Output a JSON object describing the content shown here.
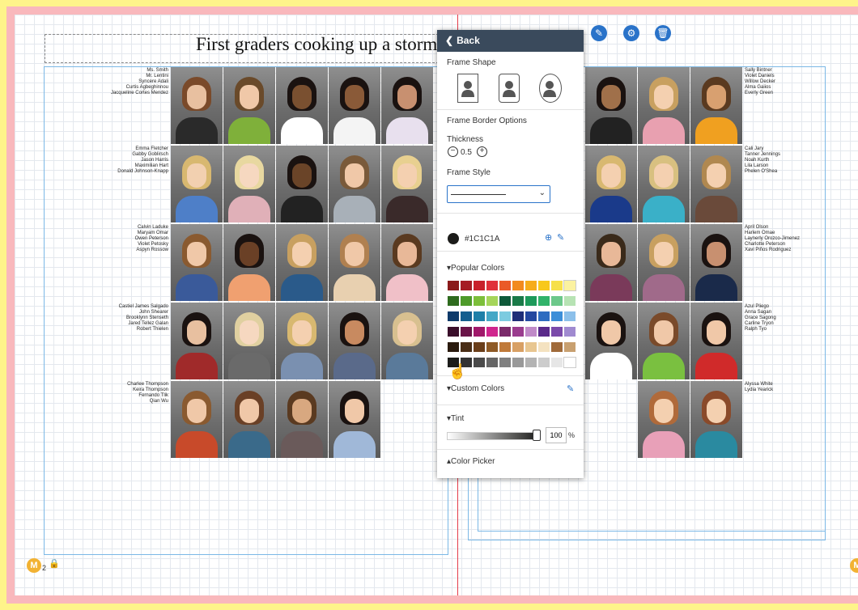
{
  "spread": {
    "title": "First graders cooking up a storm",
    "page_number": "2"
  },
  "name_groups": {
    "left": [
      [
        "Ms. Smith",
        "Mr. Lentini",
        "Syncere Adali",
        "Curtis Agbeghinnou",
        "Jacqueline Cortes Mendez"
      ],
      [
        "Emma Fletcher",
        "Gabby Goblirsch",
        "Jason Harris",
        "Maximilian Hart",
        "Donald Johnson-Knapp"
      ],
      [
        "Calvin Laduke",
        "Maryam Omar",
        "Owen Peterson",
        "Violet Petosky",
        "Aspyn Rossow"
      ],
      [
        "Castiel James Salgado",
        "John Shearer",
        "Brooklynn Stenseth",
        "Jared Tellez Galan",
        "Robert Thielen"
      ],
      [
        "Charlee Thompson",
        "Keira Thompson",
        "Fernando Tlik",
        "Qian Wu"
      ]
    ],
    "right": [
      [
        "Sally Bintner",
        "Violet Daniels",
        "Willow Decker",
        "Alma Gaiios",
        "Everly Green"
      ],
      [
        "Cali Jary",
        "Tanner Jennings",
        "Noah Kurth",
        "Lila Larson",
        "Phelen O'Shea"
      ],
      [
        "April Olson",
        "Harlem Omae",
        "Laynerly Orozco-Jimenez",
        "Charlotte Peterson",
        "Xavi Piños Rodriguez"
      ],
      [
        "Azul Pliego",
        "Anna Sagan",
        "Grace Sagong",
        "Carline Tryon",
        "Ralph Tyo"
      ],
      [
        "Alyssa White",
        "Lydia Yearick"
      ]
    ]
  },
  "toolbar_icons": [
    "pencil-icon",
    "gear-icon",
    "trash-icon"
  ],
  "panel": {
    "back_label": "Back",
    "frame_shape_label": "Frame Shape",
    "border_options_label": "Frame Border Options",
    "thickness_label": "Thickness",
    "thickness_value": "0.5",
    "frame_style_label": "Frame Style",
    "current_color": "#1C1C1A",
    "popular_colors_label": "Popular Colors",
    "custom_colors_label": "Custom Colors",
    "tint_label": "Tint",
    "tint_value": "100",
    "tint_unit": "%",
    "color_picker_label": "Color Picker"
  },
  "swatches": [
    [
      "#8b1a1a",
      "#a51c24",
      "#c8202b",
      "#e0303a",
      "#ea5a28",
      "#f28a1e",
      "#f6ac1a",
      "#f8c81c",
      "#f6e04a",
      "#fbf2a0"
    ],
    [
      "#2e6b1e",
      "#4e9a2a",
      "#7cbf3a",
      "#a5d55a",
      "#0f5a3a",
      "#1a7a48",
      "#1d9a5a",
      "#31b36a",
      "#6cc88a",
      "#b7e3b4"
    ],
    [
      "#0e3a6a",
      "#145e8e",
      "#1e7fa8",
      "#44a7c6",
      "#7ccbe0",
      "#1e2e78",
      "#2448a0",
      "#2e6cc0",
      "#3c8ed8",
      "#8cc0ea"
    ],
    [
      "#3a0e2a",
      "#6a1448",
      "#a0186a",
      "#d0268e",
      "#7a2a6a",
      "#9a3c8e",
      "#c08ac8",
      "#5a2a8a",
      "#7a4aaa",
      "#a08ad0"
    ],
    [
      "#2a1a0e",
      "#4a2e16",
      "#6a3e1a",
      "#8e5a26",
      "#c07a3a",
      "#d8a064",
      "#e8c690",
      "#f4e2c0",
      "#a06a3a",
      "#c8a070"
    ],
    [
      "#1C1C1A",
      "#333333",
      "#4a4a4a",
      "#666666",
      "#808080",
      "#999999",
      "#b3b3b3",
      "#cccccc",
      "#e6e6e6",
      "#ffffff"
    ]
  ],
  "photos_left": [
    [
      [
        "#7a4a2a",
        "#e8c0a0",
        "#2a2a2a"
      ],
      [
        "#6a4a2a",
        "#f0c8a8",
        "#7fb03a"
      ],
      [
        "#1a1210",
        "#7a5030",
        "#ffffff"
      ],
      [
        "#1a1210",
        "#8a5a38",
        "#f4f4f4"
      ],
      [
        "#1a1210",
        "#c89070",
        "#e8e0ee"
      ]
    ],
    [
      [
        "#d8b870",
        "#f2d0b0",
        "#4e7fc8"
      ],
      [
        "#e8d8a0",
        "#f6d8c0",
        "#e0b0b8"
      ],
      [
        "#1a1210",
        "#6a4428",
        "#222222"
      ],
      [
        "#7a5a3a",
        "#f0c8a8",
        "#a8b0b8"
      ],
      [
        "#e8d090",
        "#f4d0b0",
        "#3a2a2a"
      ]
    ],
    [
      [
        "#8a5a30",
        "#f0c8a8",
        "#3a5a9a"
      ],
      [
        "#1a1210",
        "#6a4026",
        "#f0a070"
      ],
      [
        "#c8a060",
        "#f4d0b0",
        "#2a5a8a"
      ],
      [
        "#b08050",
        "#f0c8a8",
        "#e8d0b0"
      ],
      [
        "#5a3a20",
        "#e8b898",
        "#f0c0c8"
      ]
    ],
    [
      [
        "#1a1210",
        "#e8c0a0",
        "#a02a2a"
      ],
      [
        "#e0d0a0",
        "#f6d8c0",
        "#6a6a6a"
      ],
      [
        "#d8b870",
        "#f4d0b0",
        "#7a90b0"
      ],
      [
        "#1a1210",
        "#c88a60",
        "#5a6a8a"
      ],
      [
        "#d8c090",
        "#f4d0b0",
        "#5a7a9a"
      ]
    ],
    [
      [
        "#8a5a30",
        "#f0c8a8",
        "#c84a2a"
      ],
      [
        "#6a4026",
        "#f0c8a8",
        "#3a6a8a"
      ],
      [
        "#5a3a20",
        "#d8a880",
        "#6a5a5a"
      ],
      [
        "#1a1210",
        "#f0c8a8",
        "#a0b8d8"
      ]
    ]
  ],
  "photos_right": [
    [
      [
        "#1a1210",
        "#a0704a",
        "#222222"
      ],
      [
        "#c8a060",
        "#f4d0b0",
        "#e8a0b0"
      ],
      [
        "#5a3a20",
        "#d8a070",
        "#f0a020"
      ]
    ],
    [
      [
        "#d8b870",
        "#f4d0b0",
        "#1a3a8a"
      ],
      [
        "#d8c080",
        "#f4d0b0",
        "#3ab0c8"
      ],
      [
        "#b08850",
        "#f4d0b0",
        "#6a4a3a"
      ]
    ],
    [
      [
        "#3a2a1a",
        "#e8b898",
        "#7a3a5a"
      ],
      [
        "#c8a060",
        "#f4d0b0",
        "#a06a8a"
      ],
      [
        "#1a1210",
        "#c89070",
        "#1a2a4a"
      ]
    ],
    [
      [
        "#1a1210",
        "#f0c8a8",
        "#ffffff"
      ],
      [
        "#7a4a2a",
        "#f0c8a8",
        "#7ac040"
      ],
      [
        "#1a1210",
        "#f0c8a8",
        "#d02a2a"
      ]
    ],
    [
      [
        "#b06a3a",
        "#f4d0b0",
        "#e8a0b8"
      ],
      [
        "#8a4a2a",
        "#f4d0b0",
        "#2a8aa0"
      ]
    ]
  ]
}
